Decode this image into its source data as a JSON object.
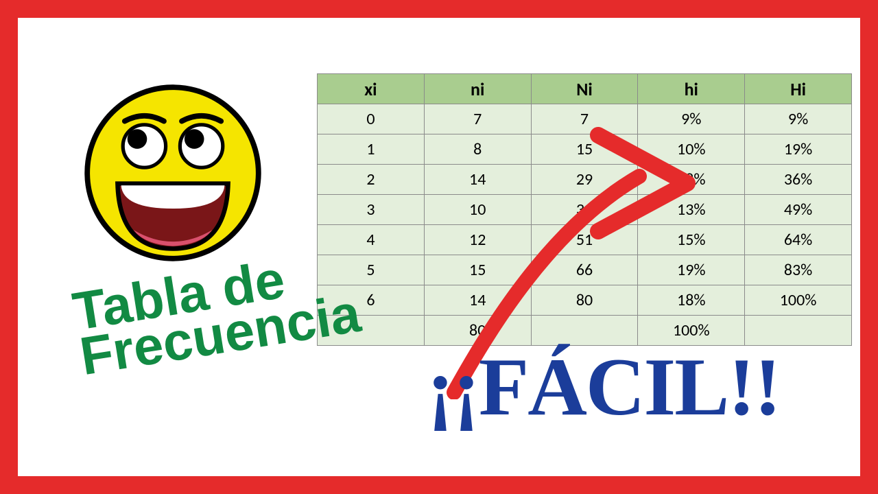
{
  "table": {
    "headers": [
      "xi",
      "ni",
      "Ni",
      "hi",
      "Hi"
    ],
    "rows": [
      [
        "0",
        "7",
        "7",
        "9%",
        "9%"
      ],
      [
        "1",
        "8",
        "15",
        "10%",
        "19%"
      ],
      [
        "2",
        "14",
        "29",
        "18%",
        "36%"
      ],
      [
        "3",
        "10",
        "39",
        "13%",
        "49%"
      ],
      [
        "4",
        "12",
        "51",
        "15%",
        "64%"
      ],
      [
        "5",
        "15",
        "66",
        "19%",
        "83%"
      ],
      [
        "6",
        "14",
        "80",
        "18%",
        "100%"
      ],
      [
        "",
        "80",
        "",
        "100%",
        ""
      ]
    ]
  },
  "titles": {
    "green": "Tabla de\nFrecuencia",
    "blue": "¡¡FÁCIL!!"
  },
  "colors": {
    "frame": "#e52b2b",
    "header_bg": "#a9cd8f",
    "cell_bg": "#e4efdc",
    "green_text": "#128a43",
    "blue_text": "#1b3d9a",
    "arrow": "#e52b2b"
  },
  "chart_data": {
    "type": "table",
    "title": "Tabla de Frecuencia",
    "columns": [
      "xi",
      "ni",
      "Ni",
      "hi",
      "Hi"
    ],
    "rows": [
      {
        "xi": 0,
        "ni": 7,
        "Ni": 7,
        "hi_pct": 9,
        "Hi_pct": 9
      },
      {
        "xi": 1,
        "ni": 8,
        "Ni": 15,
        "hi_pct": 10,
        "Hi_pct": 19
      },
      {
        "xi": 2,
        "ni": 14,
        "Ni": 29,
        "hi_pct": 18,
        "Hi_pct": 36
      },
      {
        "xi": 3,
        "ni": 10,
        "Ni": 39,
        "hi_pct": 13,
        "Hi_pct": 49
      },
      {
        "xi": 4,
        "ni": 12,
        "Ni": 51,
        "hi_pct": 15,
        "Hi_pct": 64
      },
      {
        "xi": 5,
        "ni": 15,
        "Ni": 66,
        "hi_pct": 19,
        "Hi_pct": 83
      },
      {
        "xi": 6,
        "ni": 14,
        "Ni": 80,
        "hi_pct": 18,
        "Hi_pct": 100
      }
    ],
    "totals": {
      "ni": 80,
      "hi_pct": 100
    }
  }
}
